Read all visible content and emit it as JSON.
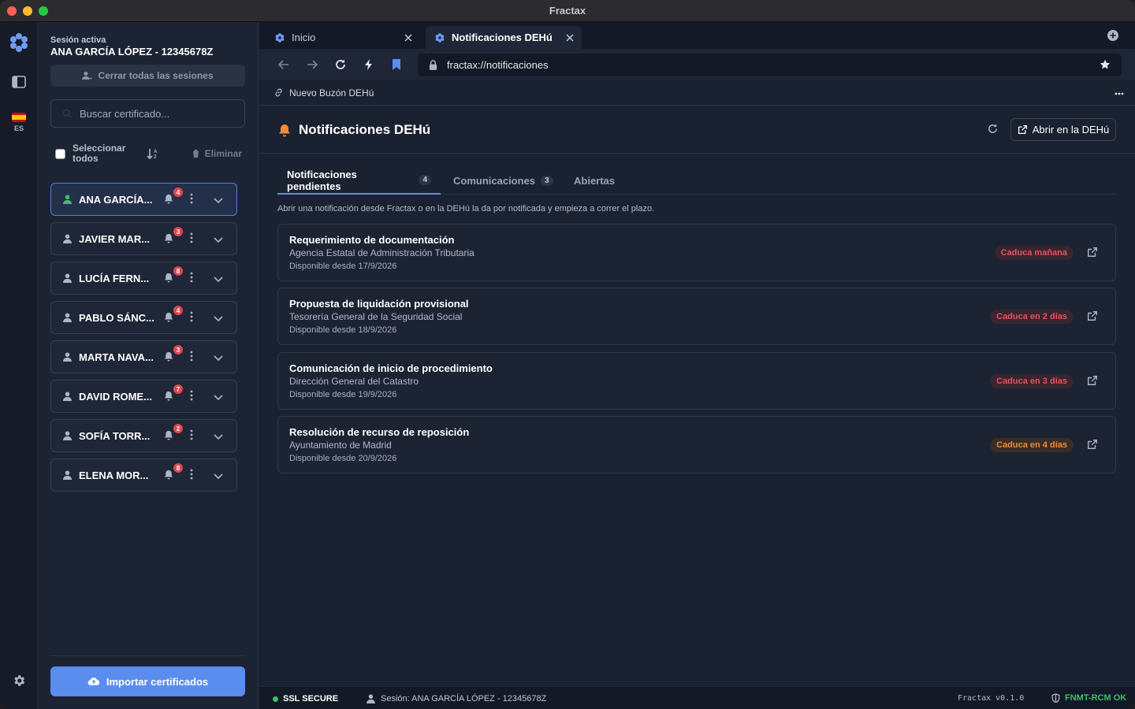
{
  "window": {
    "title": "Fractax"
  },
  "rail": {
    "lang": "ES"
  },
  "sidebar": {
    "session_label": "Sesión activa",
    "session_name": "ANA GARCÍA LÓPEZ - 12345678Z",
    "close_all_label": "Cerrar todas las sesiones",
    "search_placeholder": "Buscar certificado...",
    "select_all_label": "Seleccionar todos",
    "delete_label": "Eliminar",
    "import_label": "Importar certificados",
    "certificates": [
      {
        "name": "ANA GARCÍA...",
        "count": "4",
        "active": true
      },
      {
        "name": "JAVIER MAR...",
        "count": "3",
        "active": false
      },
      {
        "name": "LUCÍA FERN...",
        "count": "8",
        "active": false
      },
      {
        "name": "PABLO SÁNC...",
        "count": "4",
        "active": false
      },
      {
        "name": "MARTA NAVA...",
        "count": "3",
        "active": false
      },
      {
        "name": "DAVID ROME...",
        "count": "7",
        "active": false
      },
      {
        "name": "SOFÍA TORR...",
        "count": "2",
        "active": false
      },
      {
        "name": "ELENA MOR...",
        "count": "8",
        "active": false
      }
    ]
  },
  "browser": {
    "tabs": [
      {
        "label": "Inicio",
        "active": false
      },
      {
        "label": "Notificaciones DEHú",
        "active": true
      }
    ],
    "url": "fractax://notificaciones",
    "bookmark": "Nuevo Buzón DEHú"
  },
  "page": {
    "title": "Notificaciones DEHú",
    "open_button": "Abrir en la DEHú",
    "tabs": [
      {
        "label": "Notificaciones pendientes",
        "count": "4"
      },
      {
        "label": "Comunicaciones",
        "count": "3"
      },
      {
        "label": "Abiertas",
        "count": ""
      }
    ],
    "info": "Abrir una notificación desde Fractax o en la DEHú la da por notificada y empieza a correr el plazo.",
    "notifications": [
      {
        "title": "Requerimiento de documentación",
        "org": "Agencia Estatal de Administración Tributaria",
        "date": "Disponible desde 17/9/2026",
        "expiry": "Caduca mañana",
        "color": "#e5535d",
        "bg": "#3a2430"
      },
      {
        "title": "Propuesta de liquidación provisional",
        "org": "Tesorería General de la Seguridad Social",
        "date": "Disponible desde 18/9/2026",
        "expiry": "Caduca en 2 días",
        "color": "#e5535d",
        "bg": "#3a2430"
      },
      {
        "title": "Comunicación de inicio de procedimiento",
        "org": "Dirección General del Catastro",
        "date": "Disponible desde 19/9/2026",
        "expiry": "Caduca en 3 días",
        "color": "#e5535d",
        "bg": "#3a2430"
      },
      {
        "title": "Resolución de recurso de reposición",
        "org": "Ayuntamiento de Madrid",
        "date": "Disponible desde 20/9/2026",
        "expiry": "Caduca en 4 días",
        "color": "#f08a3c",
        "bg": "#3b2c25"
      }
    ]
  },
  "status": {
    "ssl": "SSL SECURE",
    "session": "Sesión: ANA GARCÍA LÓPEZ - 12345678Z",
    "version": "Fractax v0.1.0",
    "fnmt": "FNMT-RCM OK"
  }
}
